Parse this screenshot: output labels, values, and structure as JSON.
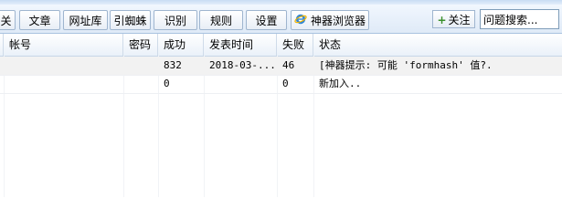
{
  "tabs": [
    {
      "label": "关"
    },
    {
      "label": "文章"
    },
    {
      "label": "网址库"
    },
    {
      "label": "引蜘蛛"
    },
    {
      "label": "识别"
    },
    {
      "label": "规则"
    },
    {
      "label": "设置"
    },
    {
      "label": "神器浏览器"
    }
  ],
  "toolbar": {
    "follow_label": "关注",
    "search_value": "问题搜索..."
  },
  "table": {
    "columns": [
      "帐号",
      "密码",
      "成功",
      "发表时间",
      "失败",
      "状态"
    ],
    "rows": [
      {
        "account": "",
        "password": "",
        "success": "832",
        "time": "2018-03-...",
        "fail": "46",
        "status": "[神器提示: 可能 'formhash' 值?."
      },
      {
        "account": "",
        "password": "",
        "success": "0",
        "time": "",
        "fail": "0",
        "status": "新加入.."
      }
    ]
  },
  "colors": {
    "tab_border": "#9fb5cf",
    "header_bg": "#eaf1f9",
    "selected_row": "#f2f2f2",
    "follow_plus": "#3a8f2b"
  }
}
